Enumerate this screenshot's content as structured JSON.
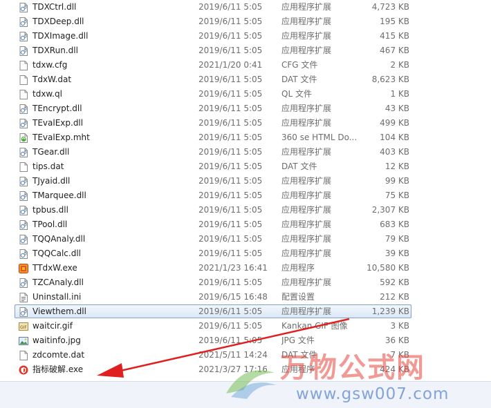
{
  "files": [
    {
      "name": "TDXCtrl.dll",
      "date": "2019/6/11 5:05",
      "type": "应用程序扩展",
      "size": "4,723 KB",
      "icon": "dll-file-icon"
    },
    {
      "name": "TDXDeep.dll",
      "date": "2019/6/11 5:05",
      "type": "应用程序扩展",
      "size": "195 KB",
      "icon": "dll-file-icon"
    },
    {
      "name": "TDXImage.dll",
      "date": "2019/6/11 5:05",
      "type": "应用程序扩展",
      "size": "415 KB",
      "icon": "dll-file-icon"
    },
    {
      "name": "TDXRun.dll",
      "date": "2019/6/11 5:05",
      "type": "应用程序扩展",
      "size": "467 KB",
      "icon": "dll-file-icon"
    },
    {
      "name": "tdxw.cfg",
      "date": "2021/1/20 0:41",
      "type": "CFG 文件",
      "size": "2 KB",
      "icon": "blank-file-icon"
    },
    {
      "name": "TdxW.dat",
      "date": "2019/6/11 5:05",
      "type": "DAT 文件",
      "size": "8,623 KB",
      "icon": "blank-file-icon"
    },
    {
      "name": "tdxw.ql",
      "date": "2019/6/11 5:05",
      "type": "QL 文件",
      "size": "1 KB",
      "icon": "blank-file-icon"
    },
    {
      "name": "TEncrypt.dll",
      "date": "2019/6/11 5:05",
      "type": "应用程序扩展",
      "size": "43 KB",
      "icon": "dll-file-icon"
    },
    {
      "name": "TEvalExp.dll",
      "date": "2019/6/11 5:05",
      "type": "应用程序扩展",
      "size": "499 KB",
      "icon": "dll-file-icon"
    },
    {
      "name": "TEvalExp.mht",
      "date": "2019/6/11 5:05",
      "type": "360 se HTML Do...",
      "size": "104 KB",
      "icon": "browser-file-icon"
    },
    {
      "name": "TGear.dll",
      "date": "2019/6/11 5:05",
      "type": "应用程序扩展",
      "size": "403 KB",
      "icon": "dll-file-icon"
    },
    {
      "name": "tips.dat",
      "date": "2019/6/11 5:05",
      "type": "DAT 文件",
      "size": "12 KB",
      "icon": "blank-file-icon"
    },
    {
      "name": "TJyaid.dll",
      "date": "2019/6/11 5:05",
      "type": "应用程序扩展",
      "size": "99 KB",
      "icon": "dll-file-icon"
    },
    {
      "name": "TMarquee.dll",
      "date": "2019/6/11 5:05",
      "type": "应用程序扩展",
      "size": "75 KB",
      "icon": "dll-file-icon"
    },
    {
      "name": "tpbus.dll",
      "date": "2019/6/11 5:05",
      "type": "应用程序扩展",
      "size": "2,307 KB",
      "icon": "dll-file-icon"
    },
    {
      "name": "TPool.dll",
      "date": "2019/6/11 5:05",
      "type": "应用程序扩展",
      "size": "683 KB",
      "icon": "dll-file-icon"
    },
    {
      "name": "TQQAnaly.dll",
      "date": "2019/6/11 5:05",
      "type": "应用程序扩展",
      "size": "79 KB",
      "icon": "dll-file-icon"
    },
    {
      "name": "TQQCalc.dll",
      "date": "2019/6/11 5:05",
      "type": "应用程序扩展",
      "size": "39 KB",
      "icon": "dll-file-icon"
    },
    {
      "name": "TTdxW.exe",
      "date": "2021/1/23 16:41",
      "type": "应用程序",
      "size": "10,580 KB",
      "icon": "app-exe-icon"
    },
    {
      "name": "TZCAnaly.dll",
      "date": "2019/6/11 5:05",
      "type": "应用程序扩展",
      "size": "592 KB",
      "icon": "dll-file-icon"
    },
    {
      "name": "Uninstall.ini",
      "date": "2019/6/15 16:48",
      "type": "配置设置",
      "size": "212 KB",
      "icon": "ini-file-icon"
    },
    {
      "name": "Viewthem.dll",
      "date": "2019/6/11 5:05",
      "type": "应用程序扩展",
      "size": "1,239 KB",
      "icon": "dll-file-icon",
      "selected": true
    },
    {
      "name": "waitcir.gif",
      "date": "2019/6/11 5:05",
      "type": "Kankan GIF 图像",
      "size": "3 KB",
      "icon": "gif-file-icon"
    },
    {
      "name": "waitinfo.jpg",
      "date": "2019/6/11 5:05",
      "type": "JPG 文件",
      "size": "36 KB",
      "icon": "image-file-icon"
    },
    {
      "name": "zdcomte.dat",
      "date": "2021/5/11 14:24",
      "type": "DAT 文件",
      "size": "7 KB",
      "icon": "blank-file-icon"
    },
    {
      "name": "指标破解.exe",
      "date": "2021/3/27 17:16",
      "type": "应用程序",
      "size": "424 KB",
      "icon": "shield-exe-icon"
    }
  ],
  "watermark": {
    "text": "万物公式网",
    "url": "www.gsw007.com"
  },
  "colors": {
    "arrow": "#e02020",
    "selection_border": "#7da2ce"
  }
}
